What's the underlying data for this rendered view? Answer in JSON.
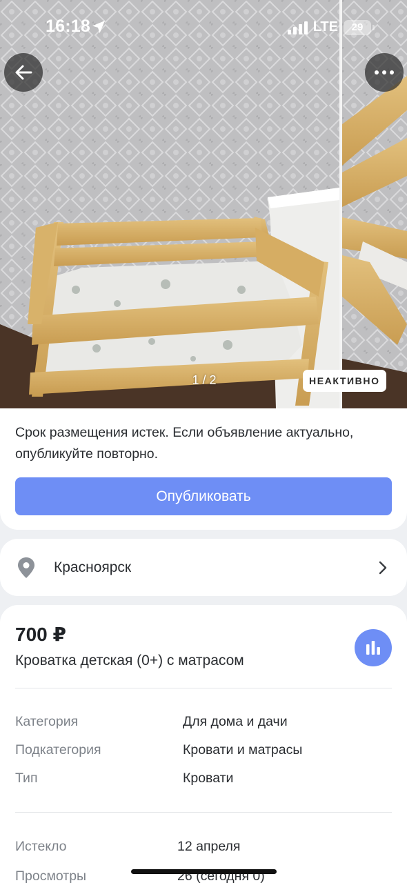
{
  "status_bar": {
    "time": "16:18",
    "network": "LTE",
    "battery": "29"
  },
  "gallery": {
    "counter": "1 / 2",
    "badge": "НЕАКТИВНО",
    "back_icon": "arrow-left-icon",
    "more_icon": "more-horizontal-icon"
  },
  "notice": {
    "text": "Срок размещения истек. Если объявление актуально, опубликуйте повторно.",
    "button": "Опубликовать"
  },
  "location": {
    "icon": "location-pin-icon",
    "city": "Красноярск"
  },
  "listing": {
    "price": "700 ₽",
    "title": "Кроватка детская (0+) с матрасом",
    "attributes": [
      {
        "key": "Категория",
        "value": "Для дома и дачи"
      },
      {
        "key": "Подкатегория",
        "value": "Кровати и матрасы"
      },
      {
        "key": "Тип",
        "value": "Кровати"
      }
    ],
    "meta": [
      {
        "key": "Истекло",
        "value": "12 апреля"
      },
      {
        "key": "Просмотры",
        "value": "26 (сегодня 0)"
      }
    ]
  },
  "colors": {
    "accent": "#6e8ef5",
    "card": "#ffffff",
    "background": "#eef0f3"
  }
}
